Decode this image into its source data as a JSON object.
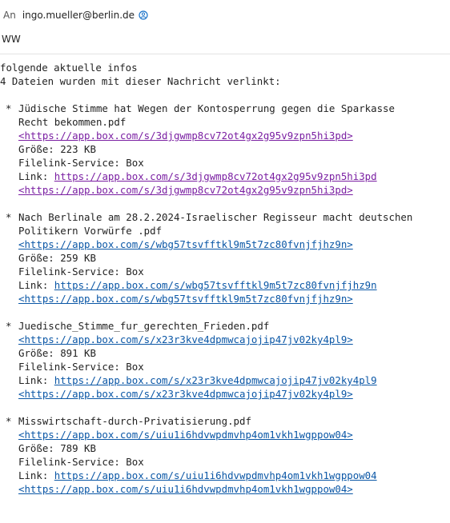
{
  "header": {
    "to_label": "An",
    "to_address": "ingo.mueller@berlin.de",
    "verified_icon": "verified-badge-icon",
    "subject": "WW"
  },
  "body": {
    "intro": "folgende aktuelle infos",
    "count_line": "4 Dateien wurden mit dieser Nachricht verlinkt:",
    "attachments": [
      {
        "title_line1": "Jüdische Stimme hat Wegen der Kontosperrung gegen die Sparkasse",
        "title_line2": "Recht bekommen.pdf",
        "url_bracketed": "<https://app.box.com/s/3djgwmp8cv72ot4gx2g95v9zpn5hi3pd>",
        "size": "Größe: 223 KB",
        "service": "Filelink-Service: Box",
        "link_label": "Link: ",
        "link_url": "https://app.box.com/s/3djgwmp8cv72ot4gx2g95v9zpn5hi3pd",
        "url_bracketed2": "<https://app.box.com/s/3djgwmp8cv72ot4gx2g95v9zpn5hi3pd>"
      },
      {
        "title_line1": "Nach Berlinale am 28.2.2024-Israelischer Regisseur macht deutschen",
        "title_line2": "Politikern Vorwürfe .pdf",
        "url_bracketed": "<https://app.box.com/s/wbg57tsvfftkl9m5t7zc80fvnjfjhz9n>",
        "size": "Größe: 259 KB",
        "service": "Filelink-Service: Box",
        "link_label": "Link: ",
        "link_url": "https://app.box.com/s/wbg57tsvfftkl9m5t7zc80fvnjfjhz9n",
        "url_bracketed2": "<https://app.box.com/s/wbg57tsvfftkl9m5t7zc80fvnjfjhz9n>"
      },
      {
        "title_line1": "Juedische_Stimme_fur_gerechten_Frieden.pdf",
        "title_line2": "",
        "url_bracketed": "<https://app.box.com/s/x23r3kve4dpmwcajojip47jv02ky4pl9>",
        "size": "Größe: 891 KB",
        "service": "Filelink-Service: Box",
        "link_label": "Link: ",
        "link_url": "https://app.box.com/s/x23r3kve4dpmwcajojip47jv02ky4pl9",
        "url_bracketed2": "<https://app.box.com/s/x23r3kve4dpmwcajojip47jv02ky4pl9>"
      },
      {
        "title_line1": "Misswirtschaft-durch-Privatisierung.pdf",
        "title_line2": "",
        "url_bracketed": "<https://app.box.com/s/uiu1i6hdvwpdmvhp4om1vkh1wgppow04>",
        "size": "Größe: 789 KB",
        "service": "Filelink-Service: Box",
        "link_label": "Link: ",
        "link_url": "https://app.box.com/s/uiu1i6hdvwpdmvhp4om1vkh1wgppow04",
        "url_bracketed2": "<https://app.box.com/s/uiu1i6hdvwpdmvhp4om1vkh1wgppow04>"
      }
    ]
  },
  "colors": {
    "link": "#0b57a6",
    "visited_link": "#7a1fa2",
    "text": "#222222"
  }
}
